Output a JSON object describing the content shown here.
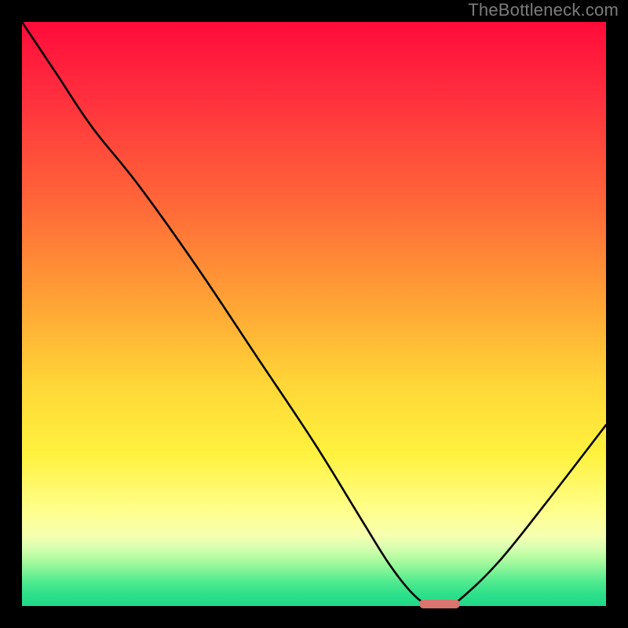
{
  "watermark": "TheBottleneck.com",
  "colors": {
    "curve": "#000000",
    "marker": "#d8756f"
  },
  "chart_data": {
    "type": "line",
    "title": "",
    "xlabel": "",
    "ylabel": "",
    "xlim": [
      0,
      100
    ],
    "ylim": [
      0,
      100
    ],
    "grid": false,
    "legend": false,
    "series": [
      {
        "name": "bottleneck-curve",
        "x": [
          0,
          6,
          12,
          20,
          30,
          40,
          50,
          58,
          63,
          67,
          70,
          73,
          76,
          82,
          90,
          100
        ],
        "y": [
          100,
          91,
          82,
          72,
          58,
          43,
          28,
          15,
          7,
          2,
          0,
          0,
          2,
          8,
          18,
          31
        ]
      }
    ],
    "marker": {
      "x_start": 68,
      "x_end": 75,
      "y": 0
    }
  }
}
